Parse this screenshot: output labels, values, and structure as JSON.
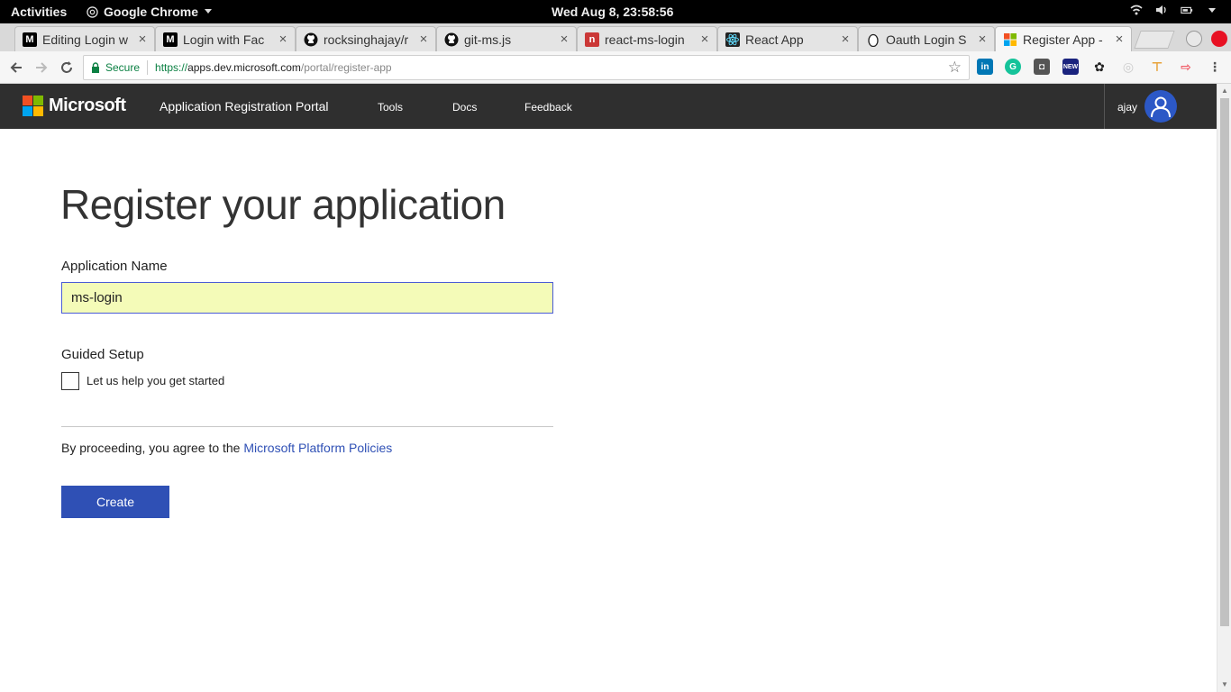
{
  "system_bar": {
    "activities": "Activities",
    "app_name": "Google Chrome",
    "clock": "Wed Aug  8, 23:58:56"
  },
  "tabs": [
    {
      "title": "Editing Login w",
      "favicon": "M",
      "favicon_color": "#000000"
    },
    {
      "title": "Login with Fac",
      "favicon": "M",
      "favicon_color": "#000000"
    },
    {
      "title": "rocksinghajay/r",
      "favicon": "github-icon",
      "favicon_color": "#000000"
    },
    {
      "title": "git-ms.js",
      "favicon": "github-icon",
      "favicon_color": "#000000"
    },
    {
      "title": "react-ms-login",
      "favicon": "n",
      "favicon_color": "#cb3837"
    },
    {
      "title": "React App",
      "favicon": "react-icon",
      "favicon_color": "#61dafb"
    },
    {
      "title": "Oauth Login S",
      "favicon": "egg-icon",
      "favicon_color": "#ffffff"
    },
    {
      "title": "Register App -",
      "favicon": "microsoft-icon",
      "favicon_color": "#f25022",
      "active": true
    }
  ],
  "address_bar": {
    "secure_label": "Secure",
    "url_scheme": "https://",
    "url_host": "apps.dev.microsoft.com",
    "url_path": "/portal/register-app"
  },
  "header": {
    "brand": "Microsoft",
    "portal_title": "Application Registration Portal",
    "nav": [
      "Tools",
      "Docs",
      "Feedback"
    ],
    "user": "ajay"
  },
  "form": {
    "title": "Register your application",
    "app_name_label": "Application Name",
    "app_name_value": "ms-login",
    "guided_setup_label": "Guided Setup",
    "guided_setup_checkbox": "Let us help you get started",
    "guided_setup_checked": false,
    "agree_text": "By proceeding, you agree to the ",
    "policy_link": "Microsoft Platform Policies",
    "create_button": "Create"
  },
  "colors": {
    "header_bg": "#2f2f2f",
    "accent": "#2f50b5",
    "input_bg": "#f4fbb8"
  }
}
